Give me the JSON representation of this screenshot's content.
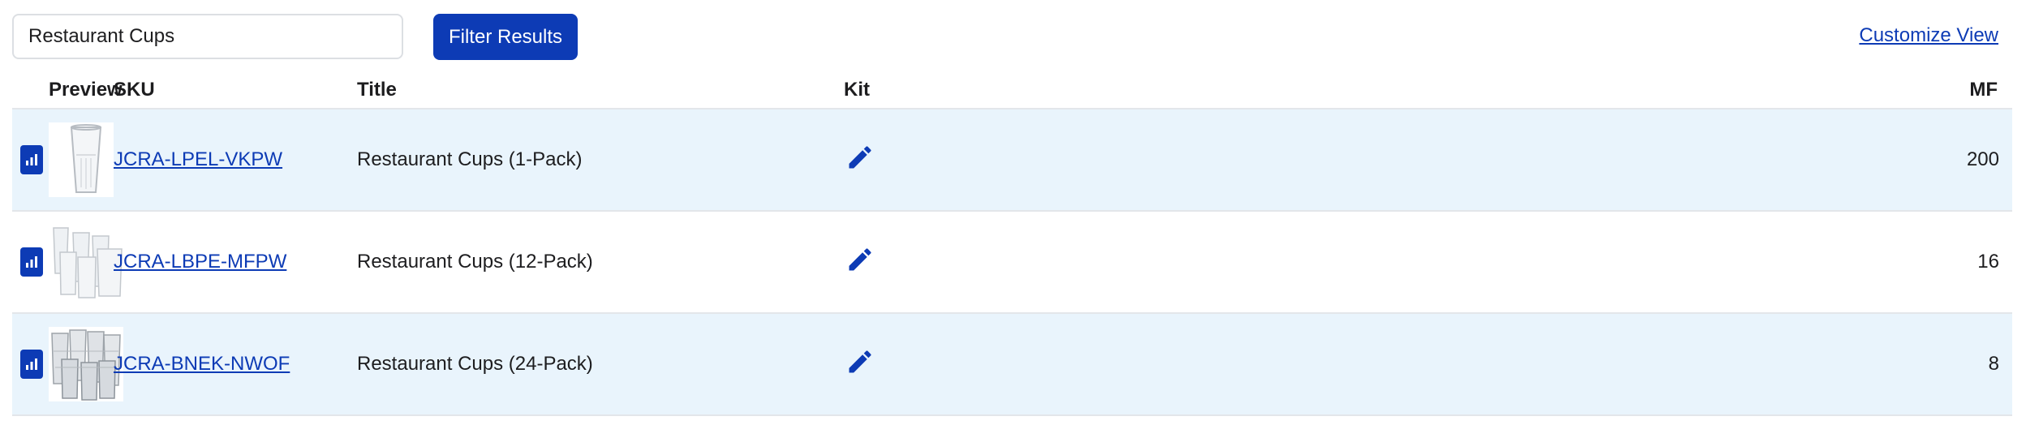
{
  "search": {
    "value": "Restaurant Cups",
    "placeholder": ""
  },
  "toolbar": {
    "filter_label": "Filter Results",
    "customize_label": "Customize View"
  },
  "table": {
    "headers": {
      "preview": "Preview",
      "sku": "SKU",
      "title": "Title",
      "kit": "Kit",
      "mf": "MF"
    },
    "rows": [
      {
        "sku": "JCRA-LPEL-VKPW",
        "title": "Restaurant Cups (1-Pack)",
        "mf": "200"
      },
      {
        "sku": "JCRA-LBPE-MFPW",
        "title": "Restaurant Cups (12-Pack)",
        "mf": "16"
      },
      {
        "sku": "JCRA-BNEK-NWOF",
        "title": "Restaurant Cups (24-Pack)",
        "mf": "8"
      }
    ]
  },
  "icons": {
    "stats": "bar-chart-icon",
    "edit": "pencil-icon",
    "preview": "cup-thumbnail"
  },
  "colors": {
    "accent": "#0d3bb5",
    "row_highlight": "#e9f4fc",
    "border": "#e3e6ea"
  }
}
